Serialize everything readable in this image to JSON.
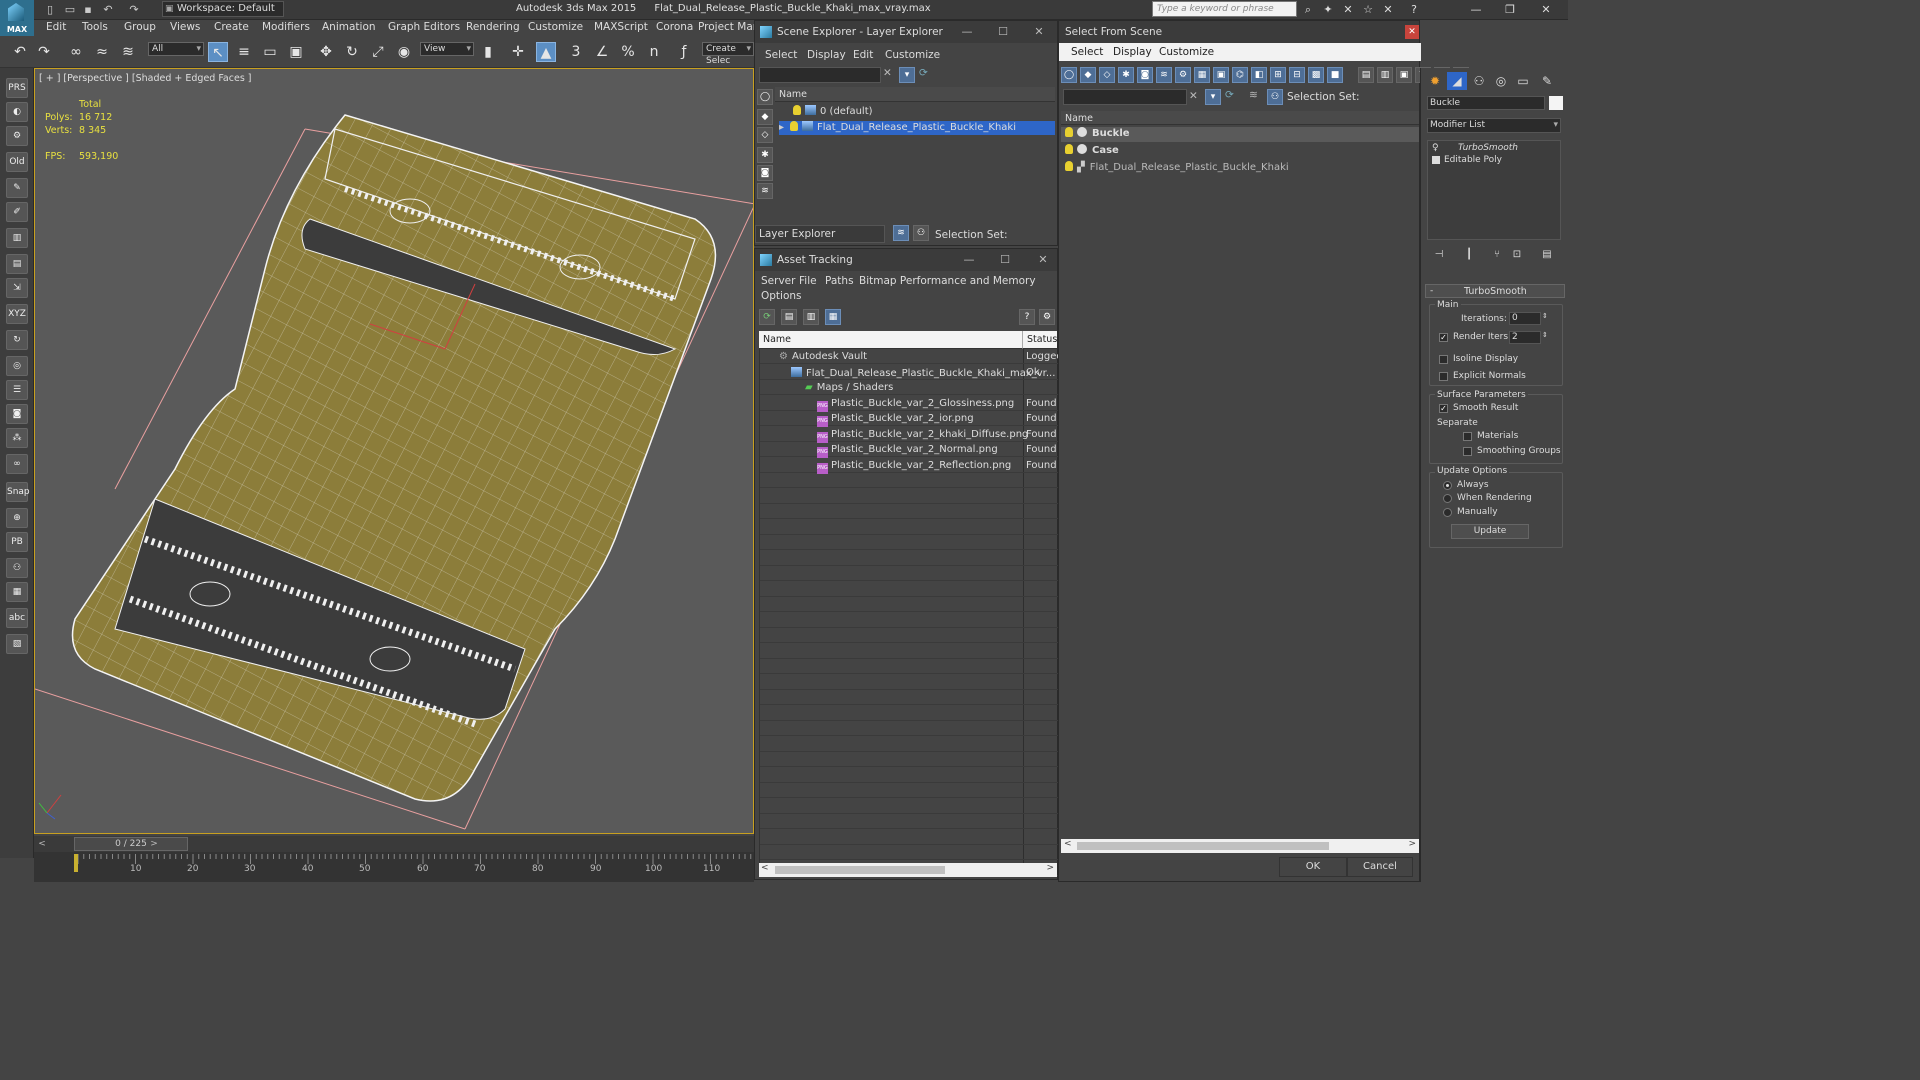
{
  "titlebar": {
    "logo_text": "MAX",
    "workspace": "Workspace: Default",
    "app_name": "Autodesk 3ds Max  2015",
    "file_name": "Flat_Dual_Release_Plastic_Buckle_Khaki_max_vray.max",
    "search_placeholder": "Type a keyword or phrase"
  },
  "menubar": [
    "Edit",
    "Tools",
    "Group",
    "Views",
    "Create",
    "Modifiers",
    "Animation",
    "Graph Editors",
    "Rendering",
    "Customize",
    "MAXScript",
    "Corona",
    "Project Man"
  ],
  "toolbar": {
    "filter_value": "All",
    "view_value": "View",
    "snap_labels": [
      "3",
      "%",
      "n"
    ],
    "create_selection": "Create Selec"
  },
  "viewport": {
    "label": "[ + ] [Perspective ] [Shaded + Edged Faces ]",
    "stats_header": "Total",
    "polys_label": "Polys:",
    "polys_value": "16 712",
    "verts_label": "Verts:",
    "verts_value": "8 345",
    "fps_label": "FPS:",
    "fps_value": "593,190",
    "model_color": "#8c7d3a"
  },
  "timeline": {
    "slider_text": "0 / 225",
    "ticks": [
      "10",
      "20",
      "30",
      "40",
      "50",
      "60",
      "70",
      "80",
      "90",
      "100",
      "110"
    ]
  },
  "scene_explorer": {
    "title": "Scene Explorer - Layer Explorer",
    "menu": [
      "Select",
      "Display",
      "Edit",
      "Customize"
    ],
    "column_name": "Name",
    "rows": [
      "0 (default)",
      "Flat_Dual_Release_Plastic_Buckle_Khaki"
    ],
    "footer_combo": "Layer Explorer",
    "selection_set": "Selection Set:"
  },
  "asset_tracking": {
    "title": "Asset Tracking",
    "menu": [
      "Server",
      "File",
      "Paths",
      "Bitmap Performance and Memory",
      "Options"
    ],
    "col_name": "Name",
    "col_status": "Status",
    "rows": [
      {
        "name": "Autodesk Vault",
        "status": "Logged",
        "indent": 0
      },
      {
        "name": "Flat_Dual_Release_Plastic_Buckle_Khaki_max_vr...",
        "status": "Ok",
        "indent": 1
      },
      {
        "name": "Maps / Shaders",
        "status": "",
        "indent": 2
      },
      {
        "name": "Plastic_Buckle_var_2_Glossiness.png",
        "status": "Found",
        "indent": 3
      },
      {
        "name": "Plastic_Buckle_var_2_ior.png",
        "status": "Found",
        "indent": 3
      },
      {
        "name": "Plastic_Buckle_var_2_khaki_Diffuse.png",
        "status": "Found",
        "indent": 3
      },
      {
        "name": "Plastic_Buckle_var_2_Normal.png",
        "status": "Found",
        "indent": 3
      },
      {
        "name": "Plastic_Buckle_var_2_Reflection.png",
        "status": "Found",
        "indent": 3
      }
    ]
  },
  "select_from_scene": {
    "title": "Select From Scene",
    "menu": [
      "Select",
      "Display",
      "Customize"
    ],
    "selection_set": "Selection Set:",
    "column_name": "Name",
    "rows": [
      "Buckle",
      "Case",
      "Flat_Dual_Release_Plastic_Buckle_Khaki"
    ],
    "ok": "OK",
    "cancel": "Cancel"
  },
  "command_panel": {
    "object_name": "Buckle",
    "modifier_list": "Modifier List",
    "stack": [
      "TurboSmooth",
      "Editable Poly"
    ],
    "rollout_title": "TurboSmooth",
    "main_label": "Main",
    "iterations_label": "Iterations:",
    "iterations_value": "0",
    "render_iters_label": "Render Iters:",
    "render_iters_value": "2",
    "isoline_display": "Isoline Display",
    "explicit_normals": "Explicit Normals",
    "surface_params": "Surface Parameters",
    "smooth_result": "Smooth Result",
    "separate": "Separate",
    "materials": "Materials",
    "smoothing_groups": "Smoothing Groups",
    "update_options": "Update Options",
    "always": "Always",
    "when_rendering": "When Rendering",
    "manually": "Manually",
    "update_button": "Update"
  }
}
